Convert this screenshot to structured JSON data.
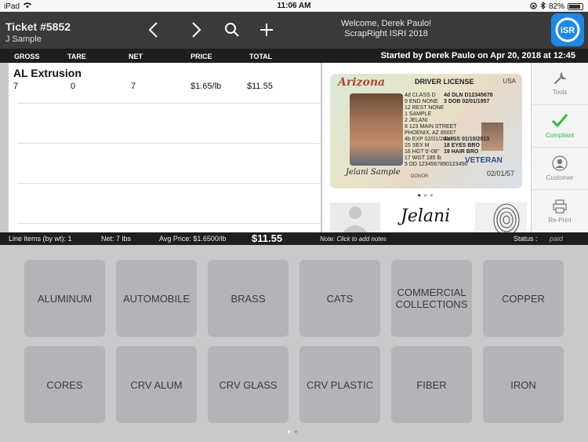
{
  "statusbar": {
    "device": "iPad",
    "time": "11:06 AM",
    "battery": "82%"
  },
  "header": {
    "ticket_title": "Ticket #5852",
    "customer_name": "J Sample",
    "welcome_line1": "Welcome, Derek Paulo!",
    "welcome_line2": "ScrapRight ISRI 2018",
    "logo_text": "iSR"
  },
  "columns": {
    "gross": "GROSS",
    "tare": "TARE",
    "net": "NET",
    "price": "PRICE",
    "total": "TOTAL",
    "started": "Started by Derek Paulo on Apr 20, 2018 at 12:45"
  },
  "line_items": [
    {
      "name": "AL Extrusion",
      "gross": "7",
      "tare": "0",
      "net": "7",
      "price": "$1.65/lb",
      "total": "$11.55"
    }
  ],
  "license": {
    "state": "Arizona",
    "type": "DRIVER LICENSE",
    "country": "USA",
    "fields_left": "4d CLASS D\n9 END NONE\n12 REST NONE\n1 SAMPLE\n2 JELANI\n8 123 MAIN STREET\nPHOENIX, AZ 85007\n4b EXP 02/01/2018\n15 SEX M\n16 HGT 5'-08\"\n17 WGT 185 lb\n5 DD 1234567890123456",
    "fields_right": "4d DLN D12345678\n3 DOB 02/01/1957\n\n\n\n\n\n4a ISS 01/10/2013\n18 EYES BRO\n19 HAIR BRO",
    "veteran": "VETERAN",
    "signature": "Jelani Sample",
    "date_small": "02/01/57",
    "donor": "DONOR"
  },
  "thumb_signature": "Jelani",
  "side_actions": {
    "tools": "Tools",
    "compliant": "Compliant",
    "customer": "Customer",
    "reprint": "Re-Print"
  },
  "summary": {
    "line_items": "Line items (by wt): 1",
    "net": "Net: 7 lbs",
    "avg_price": "Avg Price: $1.6500/lb",
    "total": "$11.55",
    "note": "Note: Click to add notes",
    "status_label": "Status :",
    "status_value": "paid"
  },
  "categories": [
    "ALUMINUM",
    "AUTOMOBILE",
    "BRASS",
    "CATS",
    "COMMERCIAL COLLECTIONS",
    "COPPER",
    "CORES",
    "CRV ALUM",
    "CRV GLASS",
    "CRV PLASTIC",
    "FIBER",
    "IRON"
  ],
  "colors": {
    "header_bg": "#3a3a3c",
    "accent_blue": "#1e88e5",
    "compliant_green": "#2ebd3c",
    "tile_bg": "#b3b3b8"
  }
}
